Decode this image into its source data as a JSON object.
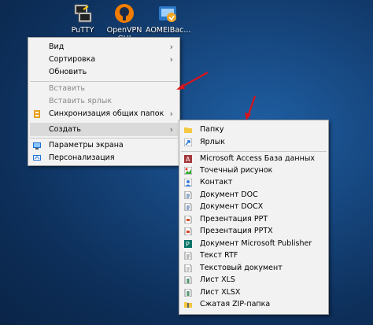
{
  "desktop": {
    "icons": [
      {
        "label": "PuTTY"
      },
      {
        "label": "OpenVPN GUI"
      },
      {
        "label": "AOMEIBac..."
      }
    ]
  },
  "context_menu": {
    "items": [
      {
        "label": "Вид",
        "submenu": true
      },
      {
        "label": "Сортировка",
        "submenu": true
      },
      {
        "label": "Обновить"
      },
      {
        "label": "Вставить",
        "disabled": true
      },
      {
        "label": "Вставить ярлык",
        "disabled": true
      },
      {
        "label": "Синхронизация общих папок",
        "submenu": true,
        "icon": "sync-icon"
      },
      {
        "label": "Создать",
        "submenu": true,
        "highlighted": true
      },
      {
        "label": "Параметры экрана",
        "icon": "display-settings-icon"
      },
      {
        "label": "Персонализация",
        "icon": "personalization-icon"
      }
    ]
  },
  "new_submenu": {
    "items": [
      {
        "label": "Папку",
        "icon": "folder-icon"
      },
      {
        "label": "Ярлык",
        "icon": "shortcut-icon"
      },
      {
        "label": "Microsoft Access База данных",
        "icon": "access-icon"
      },
      {
        "label": "Точечный рисунок",
        "icon": "bitmap-icon"
      },
      {
        "label": "Контакт",
        "icon": "contact-icon"
      },
      {
        "label": "Документ DOC",
        "icon": "doc-icon"
      },
      {
        "label": "Документ DOCX",
        "icon": "docx-icon"
      },
      {
        "label": "Презентация PPT",
        "icon": "ppt-icon"
      },
      {
        "label": "Презентация PPTX",
        "icon": "pptx-icon"
      },
      {
        "label": "Документ Microsoft Publisher",
        "icon": "publisher-icon"
      },
      {
        "label": "Текст RTF",
        "icon": "rtf-icon"
      },
      {
        "label": "Текстовый документ",
        "icon": "txt-icon"
      },
      {
        "label": "Лист XLS",
        "icon": "xls-icon"
      },
      {
        "label": "Лист XLSX",
        "icon": "xlsx-icon"
      },
      {
        "label": "Сжатая ZIP-папка",
        "icon": "zip-icon"
      }
    ]
  },
  "colors": {
    "annotation_arrow": "#d8141c",
    "menu_bg": "#f2f2f2",
    "highlight": "#dadada"
  }
}
